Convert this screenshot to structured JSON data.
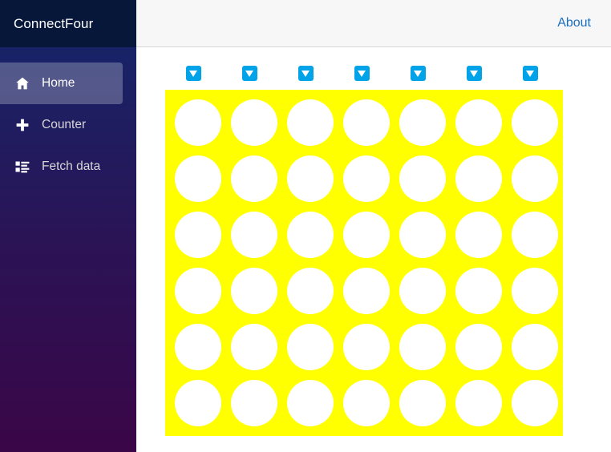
{
  "app": {
    "brand": "ConnectFour"
  },
  "sidebar": {
    "items": [
      {
        "label": "Home",
        "icon": "home-icon",
        "active": true
      },
      {
        "label": "Counter",
        "icon": "plus-icon",
        "active": false
      },
      {
        "label": "Fetch data",
        "icon": "list-icon",
        "active": false
      }
    ]
  },
  "topbar": {
    "about_label": "About"
  },
  "game": {
    "columns": 7,
    "rows": 6,
    "drop_button_label": "▼",
    "drop_buttons": [
      {
        "column": 1,
        "label": "▼"
      },
      {
        "column": 2,
        "label": "▼"
      },
      {
        "column": 3,
        "label": "▼"
      },
      {
        "column": 4,
        "label": "▼"
      },
      {
        "column": 5,
        "label": "▼"
      },
      {
        "column": 6,
        "label": "▼"
      },
      {
        "column": 7,
        "label": "▼"
      }
    ],
    "board_color": "#ffff00",
    "empty_color": "#ffffff",
    "board": [
      [
        "empty",
        "empty",
        "empty",
        "empty",
        "empty",
        "empty",
        "empty"
      ],
      [
        "empty",
        "empty",
        "empty",
        "empty",
        "empty",
        "empty",
        "empty"
      ],
      [
        "empty",
        "empty",
        "empty",
        "empty",
        "empty",
        "empty",
        "empty"
      ],
      [
        "empty",
        "empty",
        "empty",
        "empty",
        "empty",
        "empty",
        "empty"
      ],
      [
        "empty",
        "empty",
        "empty",
        "empty",
        "empty",
        "empty",
        "empty"
      ],
      [
        "empty",
        "empty",
        "empty",
        "empty",
        "empty",
        "empty",
        "empty"
      ]
    ]
  },
  "colors": {
    "brand_bg": "#071739",
    "sidebar_top": "#13276b",
    "sidebar_bottom": "#3a0647",
    "link": "#1b6ec2",
    "drop_button": "#00a2e8",
    "board": "#ffff00"
  }
}
